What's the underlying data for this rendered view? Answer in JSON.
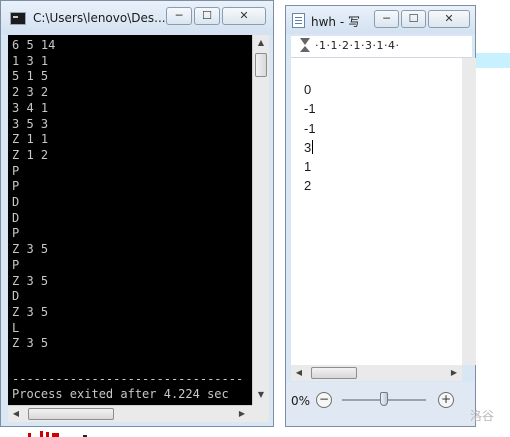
{
  "console": {
    "title": "C:\\Users\\lenovo\\Des...",
    "output_lines": [
      "6 5 14",
      "1 3 1",
      "5 1 5",
      "2 3 2",
      "3 4 1",
      "3 5 3",
      "Z 1 1",
      "Z 1 2",
      "P",
      "P",
      "D",
      "D",
      "P",
      "Z 3 5",
      "P",
      "Z 3 5",
      "D",
      "Z 3 5",
      "L",
      "Z 3 5"
    ],
    "separator": "--------------------------------",
    "exit_message": "Process exited after 4.224 sec",
    "buttons": {
      "minimize": "─",
      "maximize": "☐",
      "close": "✕"
    }
  },
  "wordpad": {
    "title": "hwh - 写...",
    "ruler_numbers": "·1·1·2·1·3·1·4·",
    "document_lines": [
      "0",
      "-1",
      "-1",
      "3",
      "1",
      "2"
    ],
    "zoom_level": "0%",
    "zoom_minus": "−",
    "zoom_plus": "+",
    "buttons": {
      "minimize": "─",
      "maximize": "☐",
      "close": "✕"
    }
  },
  "watermark": "洛谷",
  "colors": {
    "console_bg": "#000000",
    "console_text": "#c8c8c8",
    "chrome": "#d9e6f4",
    "ruler_extension": "#c8f1ff"
  }
}
